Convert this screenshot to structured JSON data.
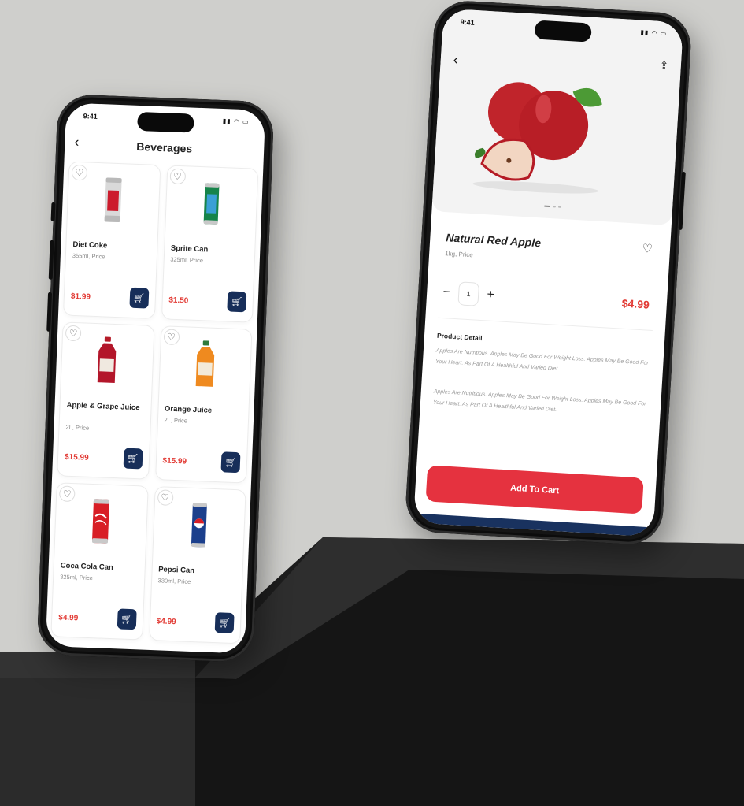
{
  "colors": {
    "accent_red": "#e5323f",
    "price_red": "#e23b35",
    "cart_navy": "#172e59",
    "background": "#cfcfcc"
  },
  "left_phone": {
    "status_time": "9:41",
    "status_icons": "signal-wifi-battery",
    "title": "Beverages",
    "back_icon": "chevron-left-icon",
    "products": [
      {
        "name": "Diet Coke",
        "size": "355ml, Price",
        "price": "$1.99",
        "image": "diet-coke-can"
      },
      {
        "name": "Sprite Can",
        "size": "325ml, Price",
        "price": "$1.50",
        "image": "sprite-can"
      },
      {
        "name": "Apple & Grape Juice",
        "size": "2L, Price",
        "price": "$15.99",
        "image": "apple-grape-bottle"
      },
      {
        "name": "Orange Juice",
        "size": "2L, Price",
        "price": "$15.99",
        "image": "orange-juice-bottle"
      },
      {
        "name": "Coca Cola Can",
        "size": "325ml, Price",
        "price": "$4.99",
        "image": "coca-cola-can"
      },
      {
        "name": "Pepsi Can",
        "size": "330ml, Price",
        "price": "$4.99",
        "image": "pepsi-can"
      }
    ]
  },
  "right_phone": {
    "status_time": "9:41",
    "product_name": "Natural Red Apple",
    "unit": "1kg, Price",
    "quantity": "1",
    "price": "$4.99",
    "detail_heading": "Product Detail",
    "detail_paragraph_1": "Apples Are Nutritious. Apples May Be Good For Weight Loss. Apples May Be Good For Your Heart. As Part Of A Healthful And Varied Diet.",
    "detail_paragraph_2": "Apples Are Nutritious. Apples May Be Good For Weight Loss. Apples May Be Good For Your Heart. As Part Of A Healthful And Varied Diet.",
    "add_to_cart_label": "Add To Cart"
  }
}
